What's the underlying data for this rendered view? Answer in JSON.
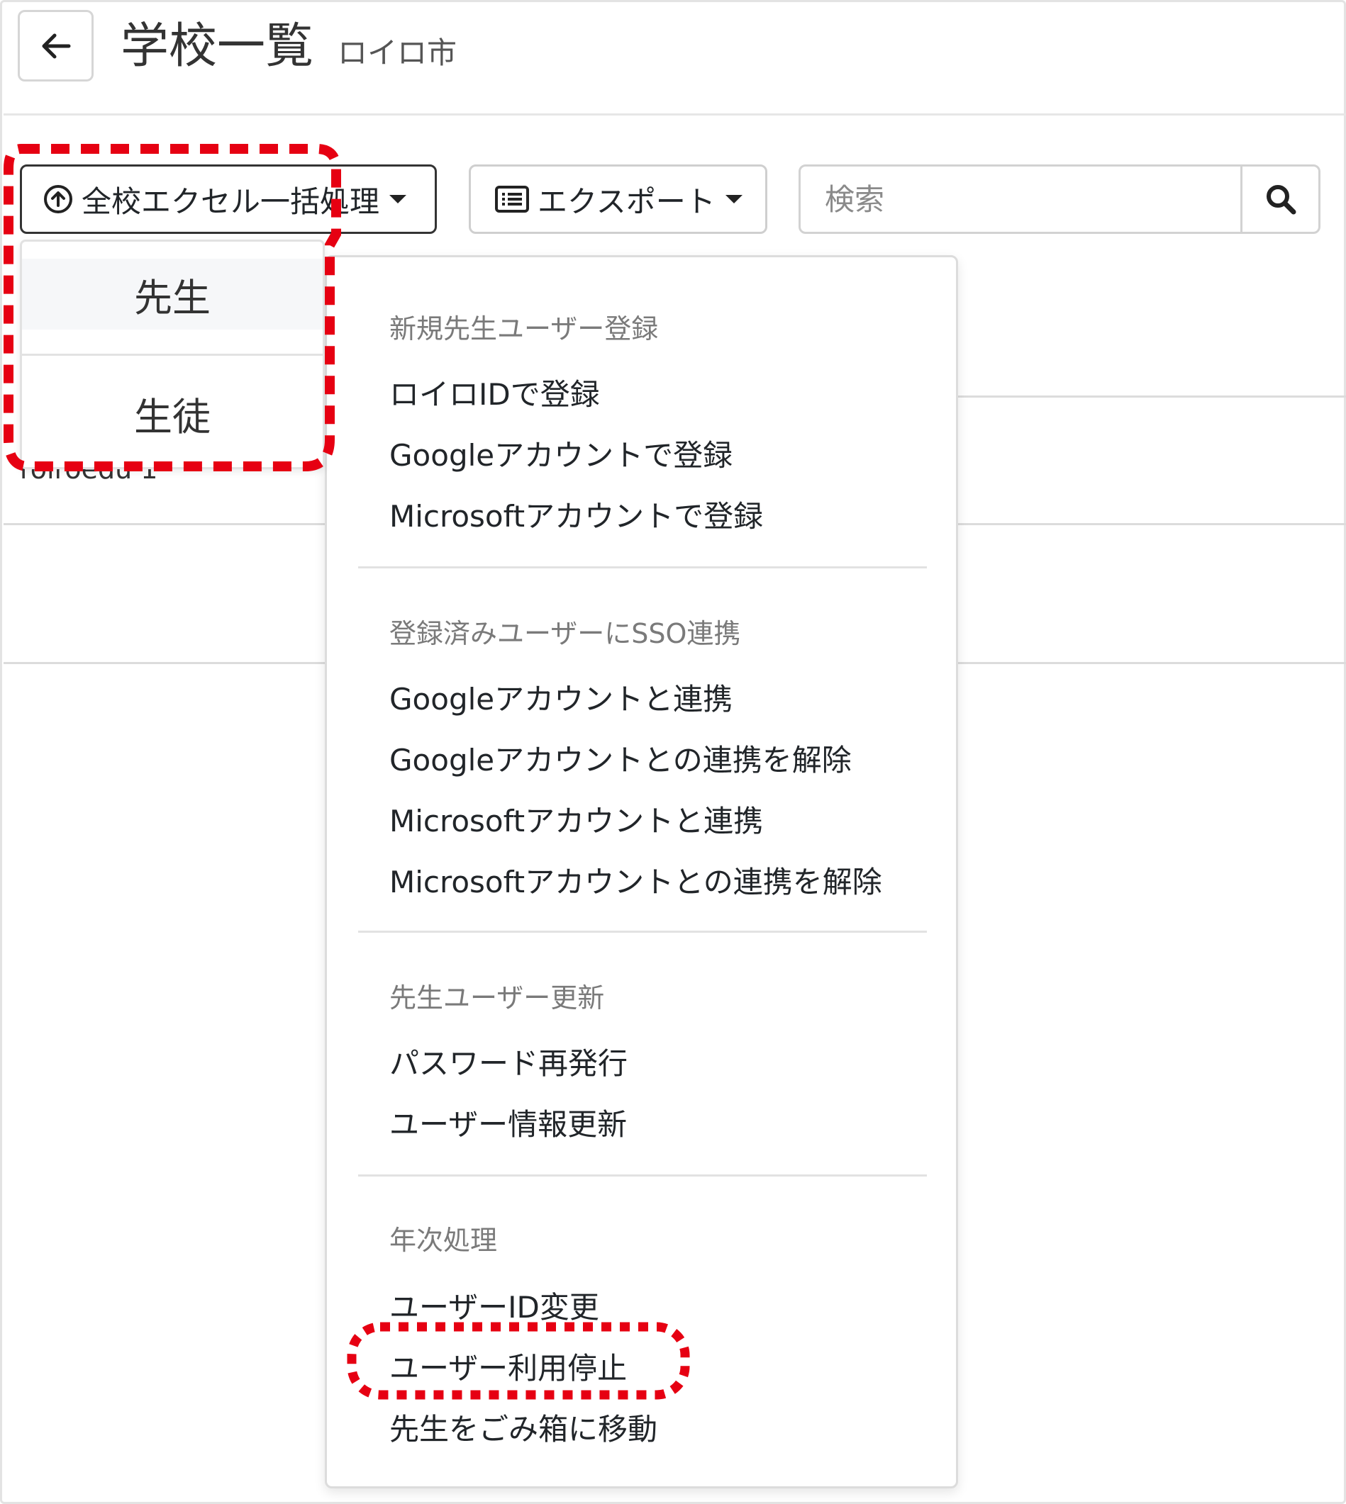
{
  "header": {
    "title": "学校一覧",
    "subtitle": "ロイロ市"
  },
  "toolbar": {
    "bulk_label": "全校エクセル一括処理",
    "export_label": "エクスポート",
    "search_placeholder": "検索"
  },
  "background": {
    "partial_text": "roiroedu 1"
  },
  "bulk_menu": {
    "items": [
      {
        "label": "先生"
      },
      {
        "label": "生徒"
      }
    ]
  },
  "teacher_submenu": {
    "groups": [
      {
        "header": "新規先生ユーザー登録",
        "items": [
          "ロイロIDで登録",
          "Googleアカウントで登録",
          "Microsoftアカウントで登録"
        ]
      },
      {
        "header": "登録済みユーザーにSSO連携",
        "items": [
          "Googleアカウントと連携",
          "Googleアカウントとの連携を解除",
          "Microsoftアカウントと連携",
          "Microsoftアカウントとの連携を解除"
        ]
      },
      {
        "header": "先生ユーザー更新",
        "items": [
          "パスワード再発行",
          "ユーザー情報更新"
        ]
      },
      {
        "header": "年次処理",
        "items": [
          "ユーザーID変更",
          "ユーザー利用停止",
          "先生をごみ箱に移動"
        ]
      }
    ]
  },
  "annotations": {
    "highlight_color": "#e60012",
    "highlighted": [
      "toolbar.bulk_label",
      "teacher_submenu.groups.3.items.1"
    ]
  }
}
